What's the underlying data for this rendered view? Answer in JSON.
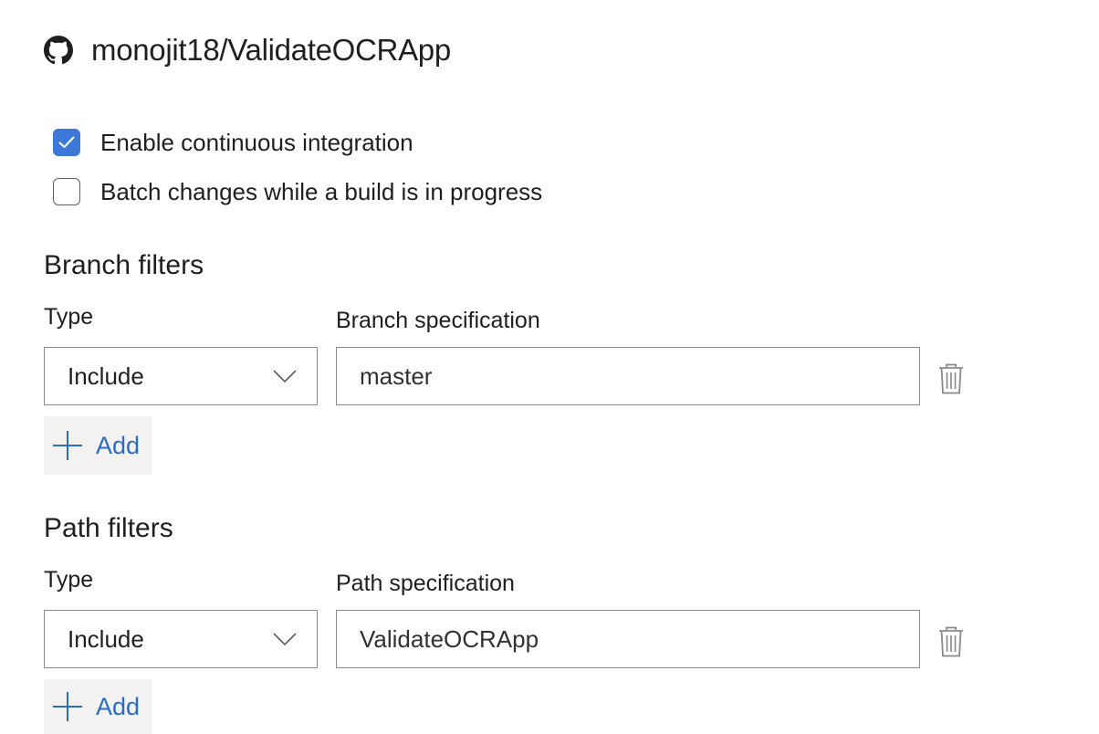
{
  "repository": {
    "icon": "github-icon",
    "name": "monojit18/ValidateOCRApp"
  },
  "options": [
    {
      "label": "Enable continuous integration",
      "checked": true
    },
    {
      "label": "Batch changes while a build is in progress",
      "checked": false
    }
  ],
  "branch_filters": {
    "title": "Branch filters",
    "type_label": "Type",
    "spec_label": "Branch specification",
    "type_value": "Include",
    "spec_value": "master",
    "add_label": "Add"
  },
  "path_filters": {
    "title": "Path filters",
    "type_label": "Type",
    "spec_label": "Path specification",
    "type_value": "Include",
    "spec_value": "ValidateOCRApp",
    "add_label": "Add"
  },
  "colors": {
    "accent": "#3c78d8",
    "link": "#2b6cc4",
    "button_bg": "#f3f2f1",
    "border": "#8a8886"
  }
}
